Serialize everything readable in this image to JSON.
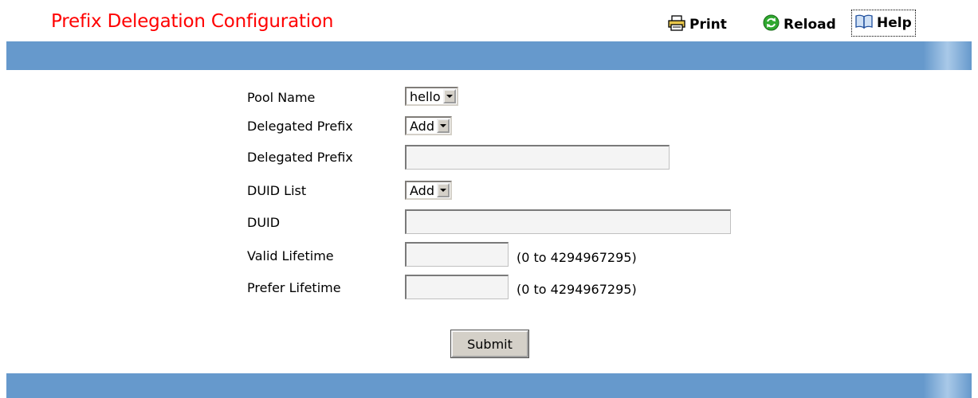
{
  "page_title": "Prefix Delegation Configuration",
  "toolbar": {
    "print_label": "Print",
    "print_icon": "printer-icon",
    "reload_label": "Reload",
    "reload_icon": "reload-icon",
    "help_label": "Help",
    "help_icon": "book-icon"
  },
  "form": {
    "pool_name": {
      "label": "Pool Name",
      "value": "hello"
    },
    "delegated_prefix_select": {
      "label": "Delegated Prefix",
      "value": "Add"
    },
    "delegated_prefix_input": {
      "label": "Delegated Prefix",
      "value": ""
    },
    "duid_list": {
      "label": "DUID List",
      "value": "Add"
    },
    "duid": {
      "label": "DUID",
      "value": ""
    },
    "valid_lifetime": {
      "label": "Valid Lifetime",
      "value": "",
      "range": "(0 to 4294967295)"
    },
    "prefer_lifetime": {
      "label": "Prefer Lifetime",
      "value": "",
      "range": "(0 to 4294967295)"
    },
    "submit_label": "Submit"
  },
  "colors": {
    "title": "#ff0000",
    "band": "#6699cc",
    "button_face": "#d4d0c8"
  }
}
